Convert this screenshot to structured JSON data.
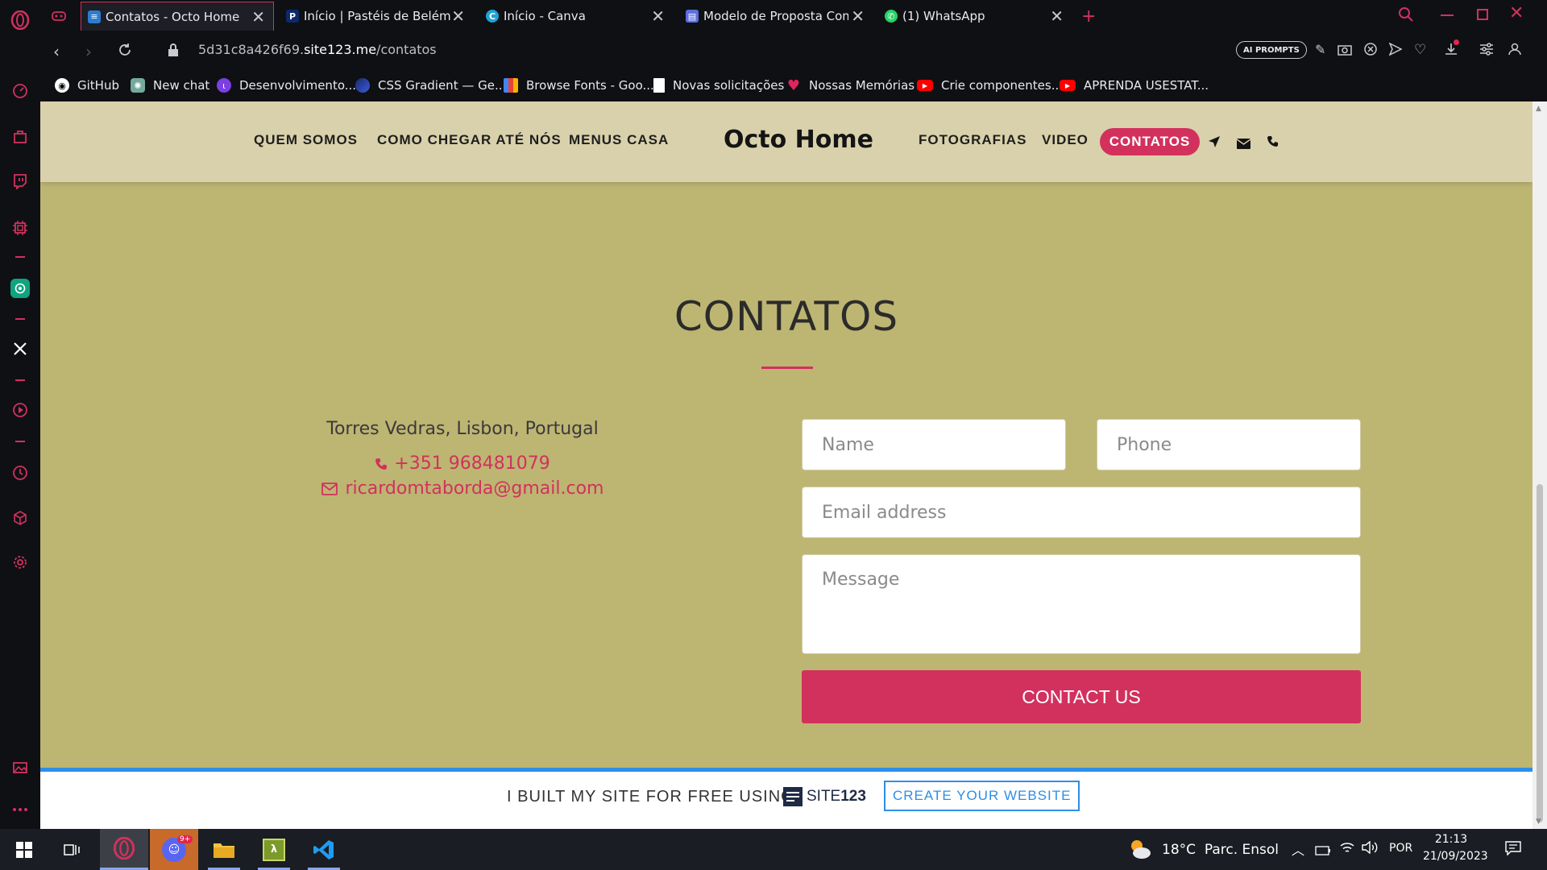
{
  "browser": {
    "tabs": [
      {
        "title": "Contatos - Octo Home",
        "favicon_color": "#2b7cd3",
        "active": true
      },
      {
        "title": "Início | Pastéis de Belém",
        "favicon_color": "#0c2a6b",
        "active": false
      },
      {
        "title": "Início - Canva",
        "favicon_color": "#1fa3d6",
        "active": false
      },
      {
        "title": "Modelo de Proposta Come",
        "favicon_color": "#5a6ee0",
        "active": false
      },
      {
        "title": "(1) WhatsApp",
        "favicon_color": "#25d366",
        "active": false
      }
    ],
    "url_prefix": "5d31c8a426f69.",
    "url_domain": "site123.me",
    "url_path": "/contatos",
    "ai_prompts_label": "AI PROMPTS",
    "bookmarks": [
      {
        "label": "GitHub",
        "icon_color": "#ffffff",
        "icon": "github-icon"
      },
      {
        "label": "New chat",
        "icon_color": "#74aa9c",
        "icon": "chatgpt-icon"
      },
      {
        "label": "Desenvolvimento...",
        "icon_color": "#7b3fe4",
        "icon": "twitch-like-icon"
      },
      {
        "label": "CSS Gradient — Ge...",
        "icon_color": "#3b5bdb",
        "icon": "css-gradient-icon"
      },
      {
        "label": "Browse Fonts - Goo...",
        "icon_color": "#f4b400",
        "icon": "google-fonts-icon"
      },
      {
        "label": "Novas solicitações",
        "icon_color": "#ffffff",
        "icon": "document-icon"
      },
      {
        "label": "Nossas Memórias",
        "icon_color": "#e0245e",
        "icon": "heart-icon"
      },
      {
        "label": "Crie componentes...",
        "icon_color": "#ff0000",
        "icon": "youtube-icon"
      },
      {
        "label": "APRENDA USESTAT...",
        "icon_color": "#ff0000",
        "icon": "youtube-icon"
      }
    ]
  },
  "site": {
    "nav_left": [
      "QUEM SOMOS",
      "COMO CHEGAR ATÉ NÓS",
      "MENUS CASA"
    ],
    "brand": "Octo Home",
    "nav_right": [
      "FOTOGRAFIAS",
      "VIDEO"
    ],
    "nav_active": "CONTATOS",
    "section_title": "CONTATOS",
    "address": "Torres Vedras, Lisbon, Portugal",
    "phone": "+351 968481079",
    "email": "ricardomtaborda@gmail.com",
    "form": {
      "name_placeholder": "Name",
      "phone_placeholder": "Phone",
      "email_placeholder": "Email address",
      "message_placeholder": "Message",
      "submit_label": "CONTACT US"
    },
    "footer_text": "I BUILT MY SITE FOR FREE USING",
    "footer_logo_text": "SITE",
    "footer_logo_num": "123",
    "footer_cta": "CREATE YOUR WEBSITE"
  },
  "colors": {
    "accent": "#d2315d",
    "page_bg": "#bdb572",
    "header_bg": "#d9d1ab",
    "footer_accent": "#2d8ee8"
  },
  "taskbar": {
    "weather_temp": "18°C",
    "weather_desc": "Parc. Ensol",
    "language": "POR",
    "time": "21:13",
    "date": "21/09/2023",
    "discord_badge": "9+"
  }
}
